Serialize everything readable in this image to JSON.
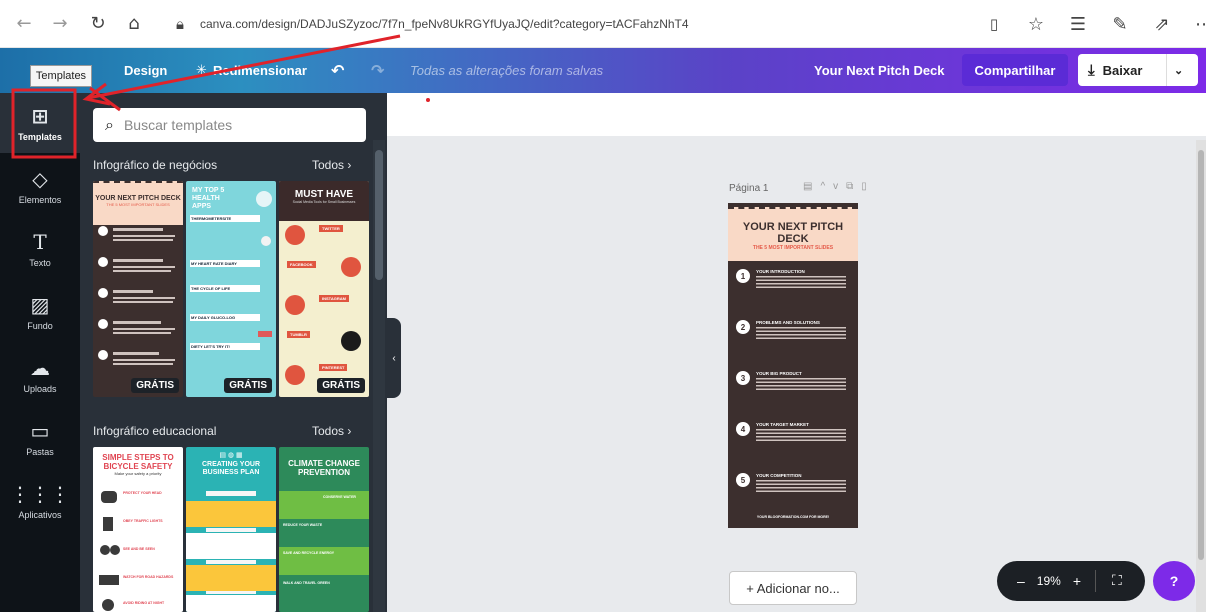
{
  "browser": {
    "url_host": "canva.com",
    "url_path": "/design/DADJuSZyzoc/7f7n_fpeNv8UkRGYfUyaJQ/edit?category=tACFahzNhT4"
  },
  "topbar": {
    "design_label": "Design",
    "resize_label": "Redimensionar",
    "saved_text": "Todas as alterações foram salvas",
    "doc_title": "Your Next Pitch Deck",
    "share_label": "Compartilhar",
    "download_label": "Baixar"
  },
  "tooltip": "Templates",
  "rail": [
    {
      "label": "Templates",
      "icon": "templates-icon",
      "active": true
    },
    {
      "label": "Elementos",
      "icon": "elements-icon"
    },
    {
      "label": "Texto",
      "icon": "text-icon"
    },
    {
      "label": "Fundo",
      "icon": "background-icon"
    },
    {
      "label": "Uploads",
      "icon": "upload-icon"
    },
    {
      "label": "Pastas",
      "icon": "folder-icon"
    },
    {
      "label": "Aplicativos",
      "icon": "apps-icon"
    }
  ],
  "panel": {
    "search_placeholder": "Buscar templates",
    "sections": [
      {
        "title": "Infográfico de negócios",
        "all_label": "Todos"
      },
      {
        "title": "Infográfico educacional",
        "all_label": "Todos"
      }
    ],
    "free_badge": "GRÁTIS",
    "business_thumbs": {
      "t1": {
        "title": "YOUR NEXT PITCH DECK",
        "subtitle": "THE 5 MOST IMPORTANT SLIDES"
      },
      "t2": {
        "title": "MY TOP 5 HEALTH APPS",
        "items": [
          "THERMOMETERSITE",
          "MY HEART RATE DIARY",
          "THE CYCLE OF LIFE",
          "MY DAILY GLUCO-LOG",
          "DIETY LET'S TRY IT!"
        ]
      },
      "t3": {
        "title": "MUST HAVE",
        "subtitle": "Social Media Tools for Small Businesses",
        "items": [
          "TWITTER",
          "FACEBOOK",
          "INSTAGRAM",
          "TUMBLR",
          "PINTEREST"
        ]
      }
    },
    "edu_thumbs": {
      "t1": {
        "title": "SIMPLE STEPS TO BICYCLE SAFETY",
        "subtitle": "Make your safety a priority",
        "items": [
          "PROTECT YOUR HEAD",
          "OBEY TRAFFIC LIGHTS",
          "SEE AND BE SEEN",
          "WATCH FOR ROAD HAZARDS",
          "AVOID RIDING AT NIGHT"
        ]
      },
      "t2": {
        "title": "CREATING YOUR BUSINESS PLAN"
      },
      "t3": {
        "title": "CLIMATE CHANGE PREVENTION",
        "items": [
          "CONSERVE WATER",
          "REDUCE YOUR WASTE",
          "SAVE AND RECYCLE ENERGY",
          "WALK AND TRAVEL GREEN"
        ]
      }
    }
  },
  "canvas": {
    "page_label": "Página 1",
    "design": {
      "title": "YOUR NEXT PITCH DECK",
      "subtitle": "THE 5 MOST IMPORTANT SLIDES",
      "items": [
        "YOUR INTRODUCTION",
        "PROBLEMS AND SOLUTIONS",
        "YOUR BIG PRODUCT",
        "YOUR TARGET MARKET",
        "YOUR COMPETITION"
      ],
      "footer": "YOUR BLOGFORMATION.COM FOR MORE!"
    },
    "add_page_label": "+ Adicionar no...",
    "zoom_level": "19%",
    "help_label": "?"
  }
}
